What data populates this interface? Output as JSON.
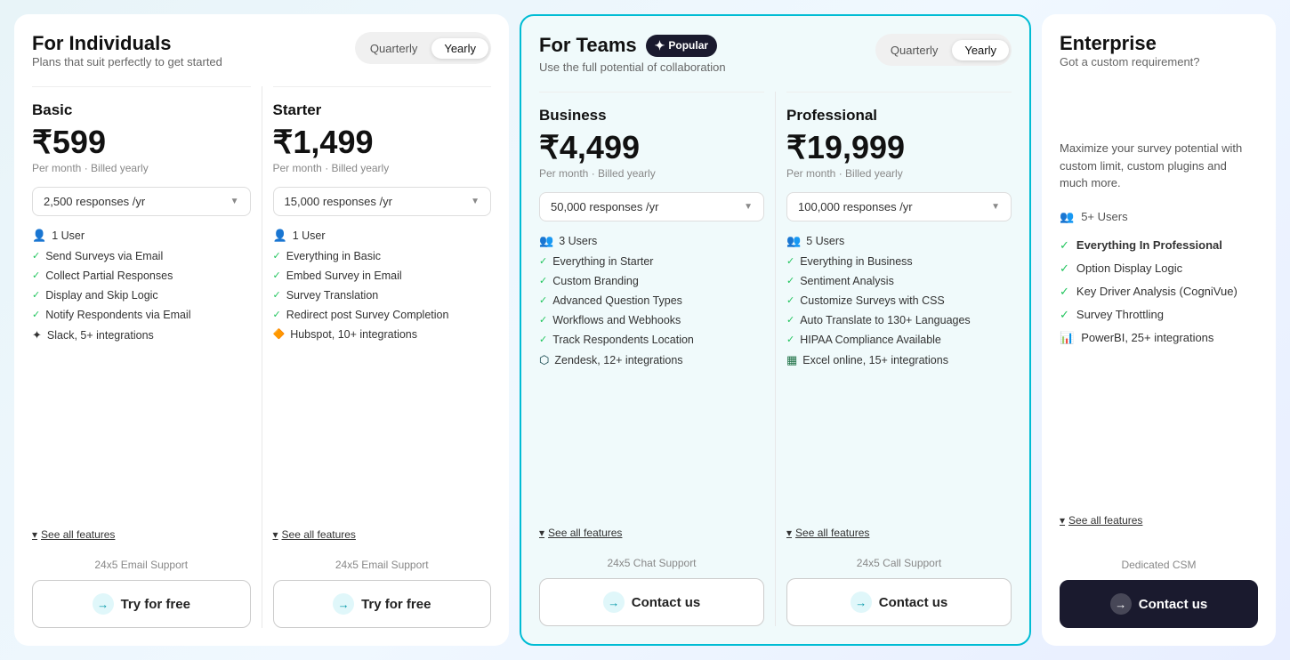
{
  "individuals": {
    "title": "For Individuals",
    "subtitle": "Plans that suit perfectly to get started",
    "toggle": {
      "quarterly": "Quarterly",
      "yearly": "Yearly",
      "active": "yearly"
    },
    "plans": [
      {
        "id": "basic",
        "name": "Basic",
        "price": "₹599",
        "period": "Per month · Billed yearly",
        "responses": "2,500 responses /yr",
        "users": "1 User",
        "features": [
          {
            "icon": "check",
            "text": "Send Surveys via Email"
          },
          {
            "icon": "check",
            "text": "Collect Partial Responses"
          },
          {
            "icon": "check",
            "text": "Display and Skip Logic"
          },
          {
            "icon": "check",
            "text": "Notify Respondents via Email"
          },
          {
            "icon": "slack",
            "text": "Slack, 5+ integrations"
          }
        ],
        "see_all": "See all features",
        "support": "24x5 Email Support",
        "cta": "Try for free"
      },
      {
        "id": "starter",
        "name": "Starter",
        "price": "₹1,499",
        "period": "Per month · Billed yearly",
        "responses": "15,000 responses /yr",
        "users": "1 User",
        "features": [
          {
            "icon": "check",
            "text": "Everything in Basic"
          },
          {
            "icon": "check",
            "text": "Embed Survey in Email"
          },
          {
            "icon": "check",
            "text": "Survey Translation"
          },
          {
            "icon": "check",
            "text": "Redirect post Survey Completion"
          },
          {
            "icon": "hubspot",
            "text": "Hubspot, 10+ integrations"
          }
        ],
        "see_all": "See all features",
        "support": "24x5 Email Support",
        "cta": "Try for free"
      }
    ]
  },
  "teams": {
    "title": "For Teams",
    "badge": "✦ Popular",
    "subtitle": "Use the full potential of collaboration",
    "toggle": {
      "quarterly": "Quarterly",
      "yearly": "Yearly",
      "active": "yearly"
    },
    "plans": [
      {
        "id": "business",
        "name": "Business",
        "price": "₹4,499",
        "period": "Per month · Billed yearly",
        "responses": "50,000 responses /yr",
        "users": "3 Users",
        "features": [
          {
            "icon": "check",
            "text": "Everything in Starter"
          },
          {
            "icon": "check",
            "text": "Custom Branding"
          },
          {
            "icon": "check",
            "text": "Advanced Question Types"
          },
          {
            "icon": "check",
            "text": "Workflows and Webhooks"
          },
          {
            "icon": "check",
            "text": "Track Respondents Location"
          },
          {
            "icon": "zendesk",
            "text": "Zendesk, 12+ integrations"
          }
        ],
        "see_all": "See all features",
        "support": "24x5 Chat Support",
        "cta": "Contact us"
      },
      {
        "id": "professional",
        "name": "Professional",
        "price": "₹19,999",
        "period": "Per month · Billed yearly",
        "responses": "100,000 responses /yr",
        "users": "5 Users",
        "features": [
          {
            "icon": "check",
            "text": "Everything in Business"
          },
          {
            "icon": "check",
            "text": "Sentiment Analysis"
          },
          {
            "icon": "check",
            "text": "Customize Surveys with CSS"
          },
          {
            "icon": "check",
            "text": "Auto Translate to 130+ Languages"
          },
          {
            "icon": "check",
            "text": "HIPAA Compliance Available"
          },
          {
            "icon": "excel",
            "text": "Excel online, 15+ integrations"
          }
        ],
        "see_all": "See all features",
        "support": "24x5 Call Support",
        "cta": "Contact us"
      }
    ]
  },
  "enterprise": {
    "title": "Enterprise",
    "subtitle": "Got a custom requirement?",
    "description": "Maximize your survey potential with custom limit, custom plugins and much more.",
    "users": "5+ Users",
    "features": [
      {
        "icon": "check",
        "text": "Everything In Professional",
        "bold": true
      },
      {
        "icon": "check",
        "text": "Option Display Logic"
      },
      {
        "icon": "check",
        "text": "Key Driver Analysis (CogniVue)"
      },
      {
        "icon": "check",
        "text": "Survey Throttling"
      },
      {
        "icon": "powerbi",
        "text": "PowerBI, 25+ integrations"
      }
    ],
    "see_all": "See all features",
    "support": "Dedicated CSM",
    "cta": "Contact us"
  }
}
